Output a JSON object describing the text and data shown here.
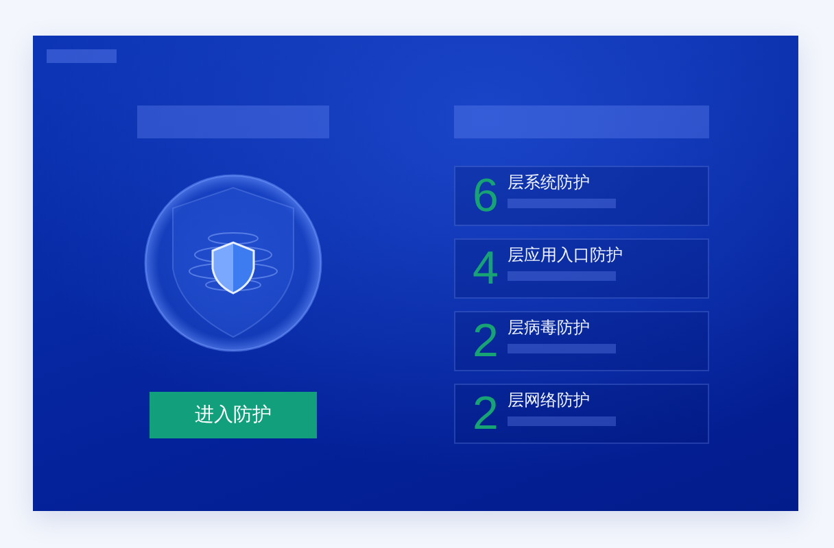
{
  "button": {
    "label": "进入防护"
  },
  "layers": [
    {
      "count": "6",
      "label": "层系统防护"
    },
    {
      "count": "4",
      "label": "层应用入口防护"
    },
    {
      "count": "2",
      "label": "层病毒防护"
    },
    {
      "count": "2",
      "label": "层网络防护"
    }
  ]
}
